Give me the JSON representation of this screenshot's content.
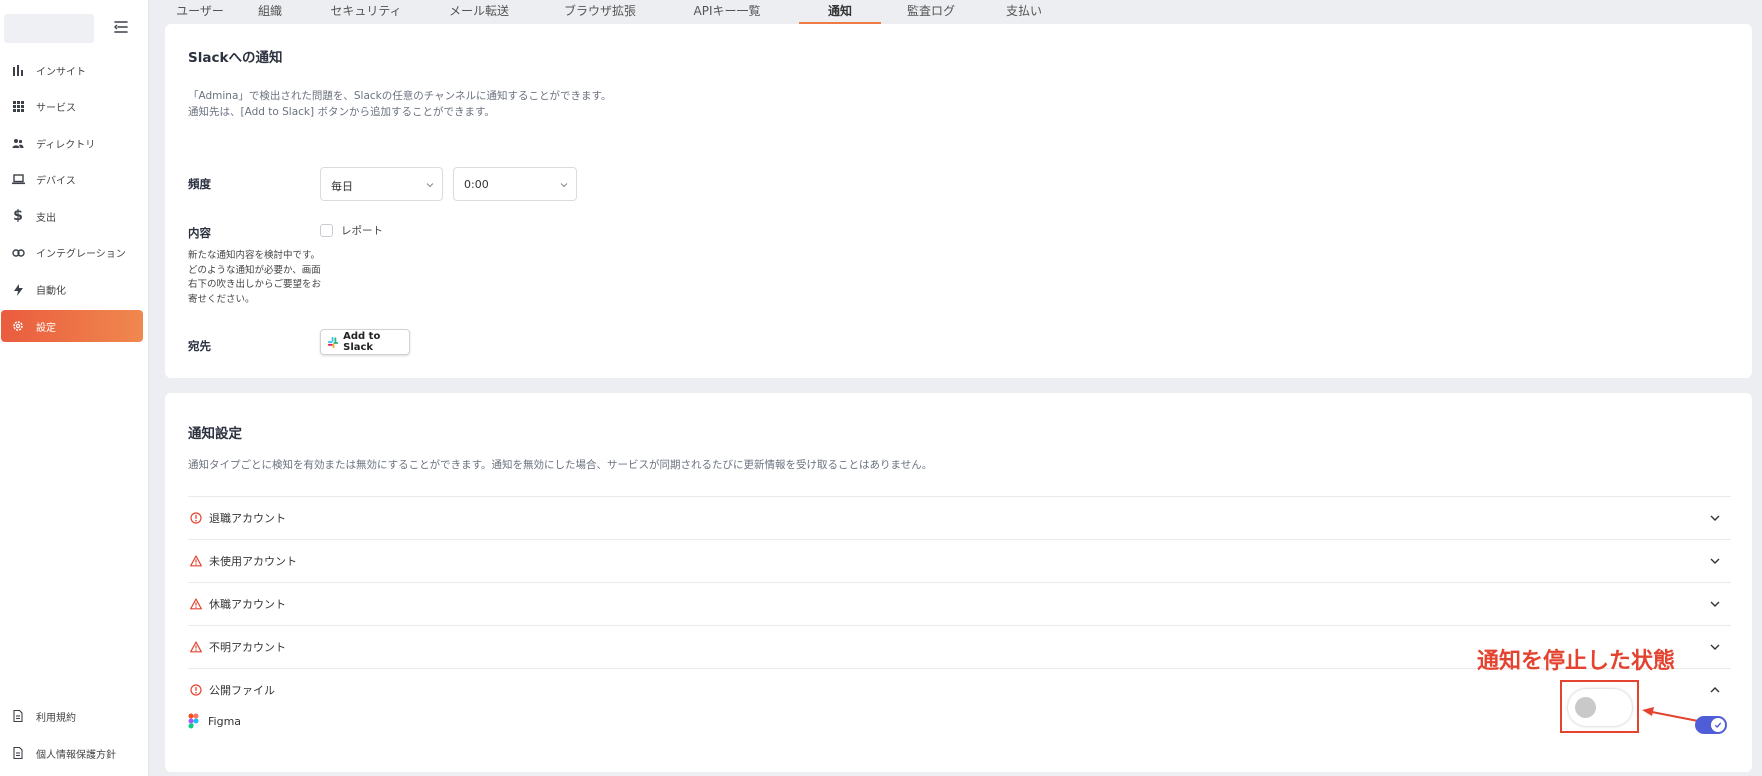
{
  "sidebar": {
    "items": [
      {
        "label": "インサイト",
        "icon": "bar-chart-icon"
      },
      {
        "label": "サービス",
        "icon": "grid-icon"
      },
      {
        "label": "ディレクトリ",
        "icon": "users-icon"
      },
      {
        "label": "デバイス",
        "icon": "laptop-icon"
      },
      {
        "label": "支出",
        "icon": "dollar-icon"
      },
      {
        "label": "インテグレーション",
        "icon": "link-icon"
      },
      {
        "label": "自動化",
        "icon": "bolt-icon"
      },
      {
        "label": "設定",
        "icon": "gear-icon",
        "active": true
      }
    ],
    "bottom": [
      {
        "label": "利用規約",
        "icon": "document-icon"
      },
      {
        "label": "個人情報保護方針",
        "icon": "document-icon"
      }
    ]
  },
  "tabs": [
    {
      "label": "ユーザー"
    },
    {
      "label": "組織"
    },
    {
      "label": "セキュリティ"
    },
    {
      "label": "メール転送"
    },
    {
      "label": "ブラウザ拡張"
    },
    {
      "label": "APIキー一覧"
    },
    {
      "label": "通知",
      "active": true
    },
    {
      "label": "監査ログ"
    },
    {
      "label": "支払い"
    }
  ],
  "slack": {
    "title": "Slackへの通知",
    "desc_line1": "「Admina」で検出された問題を、Slackの任意のチャンネルに通知することができます。",
    "desc_line2": "通知先は、[Add to Slack] ボタンから追加することができます。",
    "frequency_label": "頻度",
    "frequency_value": "毎日",
    "time_value": "0:00",
    "content_label": "内容",
    "report_label": "レポート",
    "report_checked": false,
    "help_text": "新たな通知内容を検討中です。どのような通知が必要か、画面右下の吹き出しからご要望をお寄せください。",
    "destination_label": "宛先",
    "add_button": "Add to Slack"
  },
  "notify": {
    "title": "通知設定",
    "desc": "通知タイプごとに検知を有効または無効にすることができます。通知を無効にした場合、サービスが同期されるたびに更新情報を受け取ることはありません。",
    "rows": [
      {
        "label": "退職アカウント",
        "icon": "alert-circle-icon",
        "expanded": false
      },
      {
        "label": "未使用アカウント",
        "icon": "warning-triangle-icon",
        "expanded": false
      },
      {
        "label": "休職アカウント",
        "icon": "warning-triangle-icon",
        "expanded": false
      },
      {
        "label": "不明アカウント",
        "icon": "warning-triangle-icon",
        "expanded": false
      },
      {
        "label": "公開ファイル",
        "icon": "alert-circle-icon",
        "expanded": true
      }
    ],
    "sub_item": {
      "label": "Figma",
      "icon": "figma-icon",
      "enabled": true
    }
  },
  "annotation": {
    "text": "通知を停止した状態",
    "toggle_enabled": false
  },
  "colors": {
    "accent": "#ef7a45",
    "annotation": "#e44330",
    "toggle_on": "#4f5ed8"
  }
}
